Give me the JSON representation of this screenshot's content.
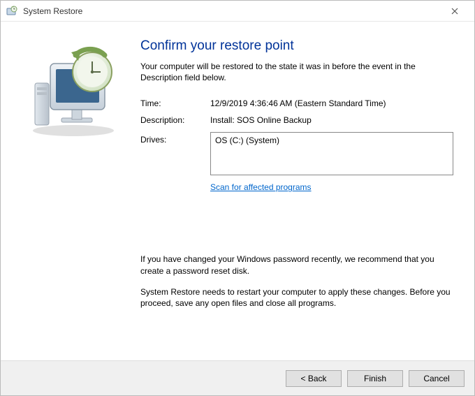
{
  "window": {
    "title": "System Restore"
  },
  "main": {
    "heading": "Confirm your restore point",
    "subtext": "Your computer will be restored to the state it was in before the event in the Description field below.",
    "fields": {
      "time_label": "Time:",
      "time_value": "12/9/2019 4:36:46 AM (Eastern Standard Time)",
      "description_label": "Description:",
      "description_value": "Install: SOS Online Backup",
      "drives_label": "Drives:",
      "drives_value": "OS (C:) (System)"
    },
    "scan_link": "Scan for affected programs",
    "note1": "If you have changed your Windows password recently, we recommend that you create a password reset disk.",
    "note2": "System Restore needs to restart your computer to apply these changes. Before you proceed, save any open files and close all programs."
  },
  "footer": {
    "back": "< Back",
    "finish": "Finish",
    "cancel": "Cancel"
  }
}
